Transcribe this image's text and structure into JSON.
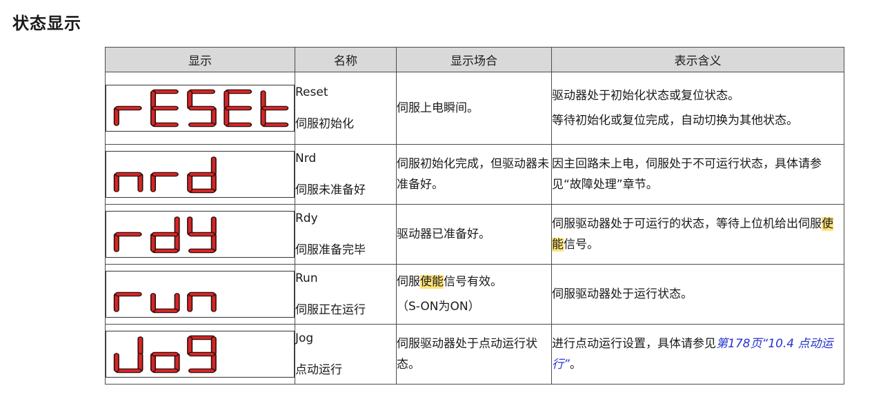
{
  "section_title": "状态显示",
  "columns": [
    "显示",
    "名称",
    "显示场合",
    "表示含义"
  ],
  "segment_color": "#d42626",
  "highlight_color": "#ffe37a",
  "link_color": "#2433c9",
  "rows": [
    {
      "display_code": "rESEt",
      "name_en": "Reset",
      "name_cn": "伺服初始化",
      "occasion": [
        "伺服上电瞬间。"
      ],
      "meaning": [
        "驱动器处于初始化状态或复位状态。",
        "等待初始化或复位完成，自动切换为其他状态。"
      ]
    },
    {
      "display_code": "nrd",
      "name_en": "Nrd",
      "name_cn": "伺服未准备好",
      "occasion": [
        "伺服初始化完成，但驱动器未准备好。"
      ],
      "meaning": [
        "因主回路未上电，伺服处于不可运行状态，具体请参见“故障处理”章节。"
      ]
    },
    {
      "display_code": "rdy",
      "name_en": "Rdy",
      "name_cn": "伺服准备完毕",
      "occasion": [
        "驱动器已准备好。"
      ],
      "meaning_pre": "伺服驱动器处于可运行的状态，等待上位机给出伺服",
      "meaning_hl": "使能",
      "meaning_post": "信号。"
    },
    {
      "display_code": "run",
      "name_en": "Run",
      "name_cn": "伺服正在运行",
      "occasion_pre": "伺服",
      "occasion_hl": "使能",
      "occasion_post": "信号有效。",
      "occasion_2": "（S-ON为ON）",
      "meaning": [
        "伺服驱动器处于运行状态。"
      ]
    },
    {
      "display_code": "Jog",
      "name_en": "Jog",
      "name_cn": "点动运行",
      "occasion": [
        "伺服驱动器处于点动运行状态。"
      ],
      "meaning_pre": "进行点动运行设置，具体请参见",
      "meaning_link": "第178页“10.4 点动运行”",
      "meaning_post": "。"
    }
  ]
}
